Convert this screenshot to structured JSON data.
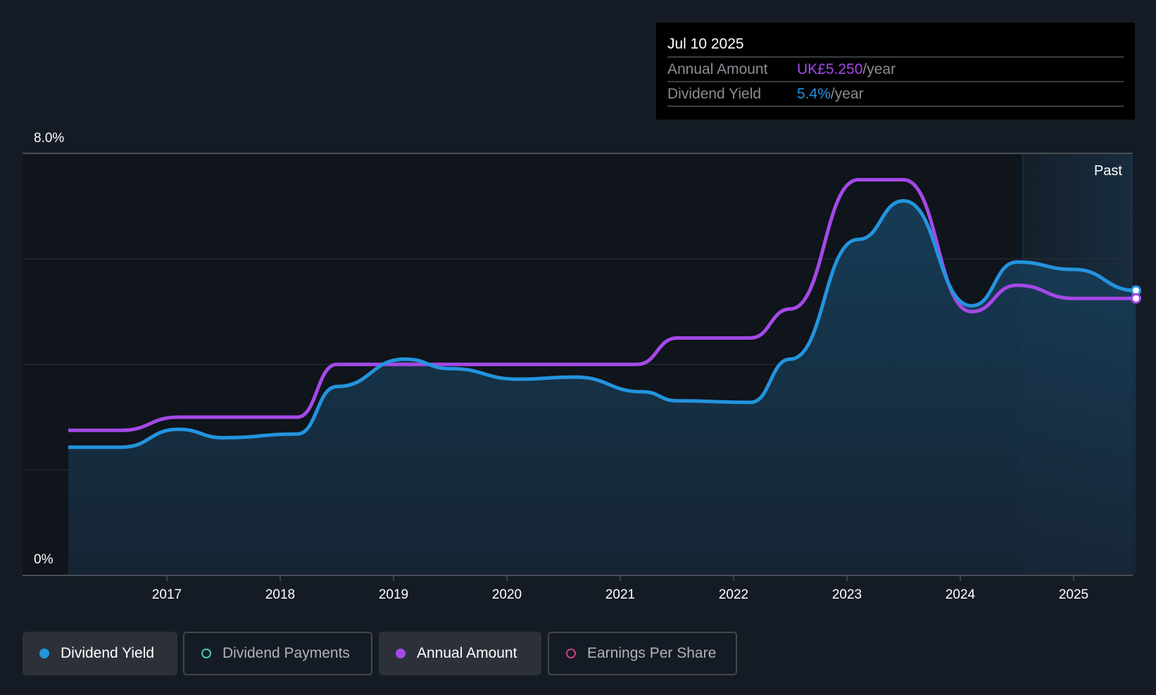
{
  "chart_data": {
    "type": "line",
    "x_axis": {
      "ticks": [
        "2017",
        "2018",
        "2019",
        "2020",
        "2021",
        "2022",
        "2023",
        "2024",
        "2025"
      ],
      "range": [
        2016.0,
        2025.55
      ]
    },
    "y_axis": {
      "tick_labels": [
        "8.0%",
        "0%"
      ],
      "range": [
        0,
        8
      ],
      "grid": true,
      "unit": "%"
    },
    "region_label": "Past",
    "past_region_start": 2024.55,
    "series": [
      {
        "name": "Dividend Yield",
        "color": "#2394df",
        "unit": "%",
        "filled": true,
        "x": [
          2016.13,
          2016.6,
          2017.1,
          2017.5,
          2018.15,
          2018.5,
          2019.1,
          2019.5,
          2020.1,
          2020.6,
          2021.2,
          2021.5,
          2022.15,
          2022.5,
          2023.1,
          2023.5,
          2024.1,
          2024.5,
          2025.0,
          2025.55
        ],
        "y": [
          2.43,
          2.43,
          2.77,
          2.61,
          2.68,
          3.58,
          4.1,
          3.92,
          3.72,
          3.76,
          3.48,
          3.31,
          3.28,
          4.1,
          6.37,
          7.1,
          5.11,
          5.94,
          5.8,
          5.4
        ]
      },
      {
        "name": "Annual Amount",
        "color": "#a449e8",
        "unit": "UK£",
        "x": [
          2016.13,
          2016.6,
          2017.1,
          2018.15,
          2018.5,
          2021.15,
          2021.5,
          2022.15,
          2022.5,
          2023.1,
          2023.5,
          2024.1,
          2024.5,
          2025.0,
          2025.55
        ],
        "y": [
          2.75,
          2.75,
          3.0,
          3.0,
          4.0,
          4.0,
          4.5,
          4.5,
          5.05,
          7.5,
          7.5,
          5.0,
          5.5,
          5.25,
          5.25
        ]
      }
    ]
  },
  "tooltip": {
    "date": "Jul 10 2025",
    "rows": [
      {
        "label": "Annual Amount",
        "value": "UK£5.250",
        "unit": "/year",
        "color": "#a449e8"
      },
      {
        "label": "Dividend Yield",
        "value": "5.4%",
        "unit": "/year",
        "color": "#2394df"
      }
    ]
  },
  "legend": [
    {
      "label": "Dividend Yield",
      "color": "#2394df",
      "active": true
    },
    {
      "label": "Dividend Payments",
      "color": "#4fc7b5",
      "active": false
    },
    {
      "label": "Annual Amount",
      "color": "#a449e8",
      "active": true
    },
    {
      "label": "Earnings Per Share",
      "color": "#c2457f",
      "active": false
    }
  ]
}
